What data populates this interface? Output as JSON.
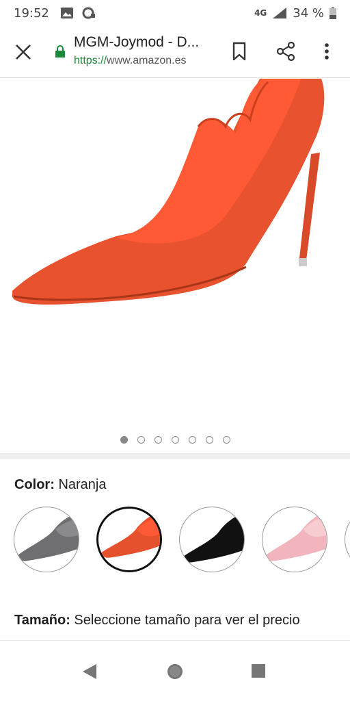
{
  "status_bar": {
    "time": "19:52",
    "network": "4G",
    "battery": "34 %"
  },
  "browser": {
    "page_title": "MGM-Joymod - D...",
    "url_scheme": "https://",
    "url_domain": "www.amazon.es"
  },
  "carousel": {
    "total": 7,
    "active_index": 0
  },
  "product": {
    "color_label": "Color:",
    "color_value": "Naranja",
    "size_label": "Tamaño:",
    "size_value": "Seleccione tamaño para ver el precio",
    "swatches": [
      {
        "name": "gray",
        "hex": "#6f6f72"
      },
      {
        "name": "orange",
        "hex": "#e5502d"
      },
      {
        "name": "black",
        "hex": "#111111"
      },
      {
        "name": "pink",
        "hex": "#f3b5bd"
      }
    ]
  },
  "colors": {
    "accent_lock": "#1a8a3a",
    "shoe_orange": "#e8522e",
    "shoe_inner": "#ff5a35"
  }
}
